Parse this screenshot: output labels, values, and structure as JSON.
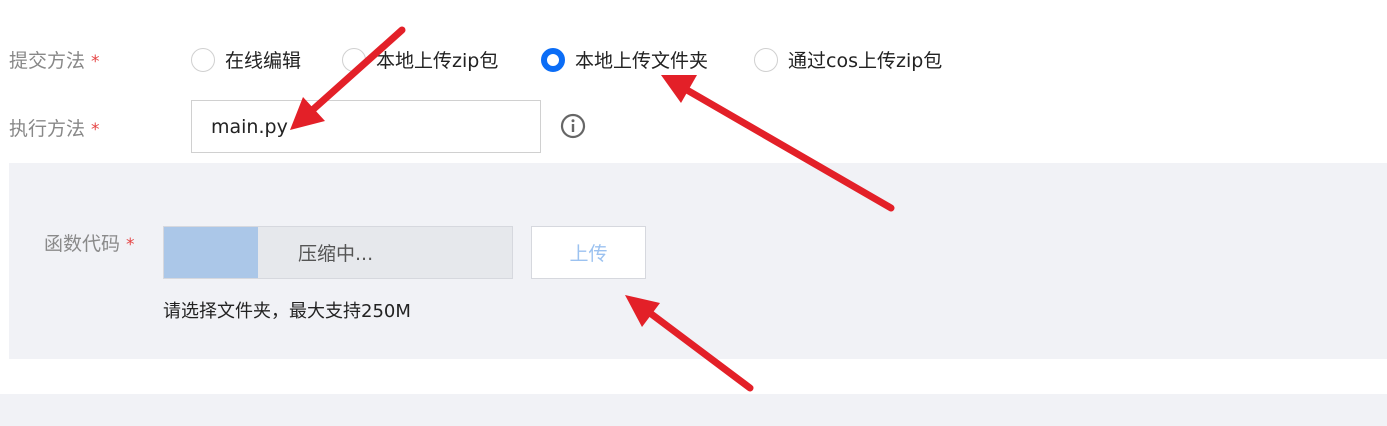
{
  "form": {
    "submit_method": {
      "label": "提交方法",
      "required_mark": "*",
      "options": [
        {
          "label": "在线编辑",
          "checked": false
        },
        {
          "label": "本地上传zip包",
          "checked": false
        },
        {
          "label": "本地上传文件夹",
          "checked": true
        },
        {
          "label": "通过cos上传zip包",
          "checked": false
        }
      ]
    },
    "exec_method": {
      "label": "执行方法",
      "required_mark": "*",
      "value": "main.py",
      "info_icon": "info-circle-icon"
    },
    "function_code": {
      "label": "函数代码",
      "required_mark": "*",
      "progress_text": "压缩中...",
      "progress_fraction": 0.27,
      "upload_label": "上传",
      "hint": "请选择文件夹，最大支持250M"
    }
  },
  "colors": {
    "accent": "#0b6df6",
    "required": "#e54545",
    "panel_bg": "#f1f2f6",
    "progress_fill": "#abc7e8",
    "annotation_arrow": "#e32028"
  }
}
